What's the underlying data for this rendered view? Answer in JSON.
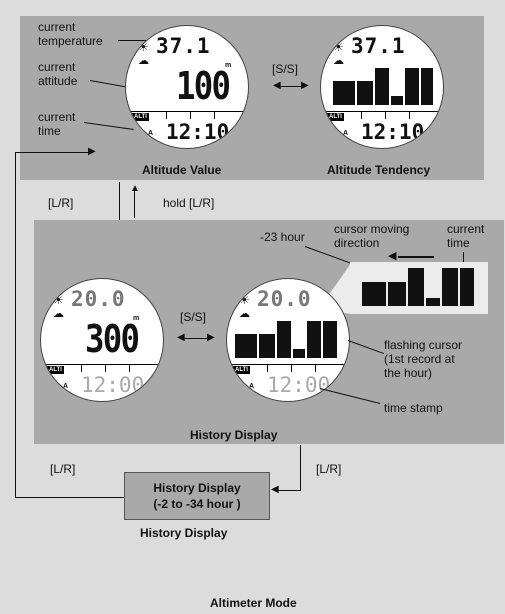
{
  "title": "Altimeter Mode",
  "top_panel": {
    "labels": {
      "current_temperature": [
        "current",
        "temperature"
      ],
      "current_attitude": [
        "current",
        "attitude"
      ],
      "current_time": [
        "current",
        "time"
      ]
    },
    "left_display": {
      "temperature": "37.1",
      "temp_unit": "°C",
      "value": "100",
      "value_unit": "m",
      "badge": "ALTI",
      "ampm": "A",
      "time": "12:10",
      "caption": "Altitude Value"
    },
    "right_display": {
      "temperature": "37.1",
      "temp_unit": "°C",
      "badge": "ALTI",
      "ampm": "A",
      "time": "12:10",
      "caption": "Altitude Tendency",
      "bars": [
        0.55,
        0.55,
        0.85,
        0.3,
        0.85,
        0.85
      ]
    },
    "switch_label": "[S/S]"
  },
  "transitions": {
    "down": "[L/R]",
    "up": "hold [L/R]",
    "bottom_right": "[L/R]",
    "bottom_left": "[L/R]"
  },
  "history_panel": {
    "left_display": {
      "temperature": "20.0",
      "temp_unit": "°C",
      "value": "300",
      "value_unit": "m",
      "badge": "ALTI",
      "ampm": "A",
      "time": "12:00"
    },
    "right_display": {
      "temperature": "20.0",
      "temp_unit": "°C",
      "badge": "ALTI",
      "ampm": "A",
      "time": "12:00",
      "bars": [
        0.55,
        0.55,
        0.85,
        0.3,
        0.85,
        0.85
      ]
    },
    "switch_label": "[S/S]",
    "caption": "History Display",
    "annotations": {
      "minus_23_hour": "-23 hour",
      "cursor_direction": [
        "cursor moving",
        "direction"
      ],
      "current_time": [
        "current",
        "time"
      ],
      "flashing_cursor": [
        "flashing cursor",
        "(1st record at",
        "the hour)"
      ],
      "time_stamp": "time stamp"
    }
  },
  "history_box": {
    "lines": [
      "History Display",
      "(-2 to -34 hour )"
    ],
    "caption": "History Display"
  }
}
